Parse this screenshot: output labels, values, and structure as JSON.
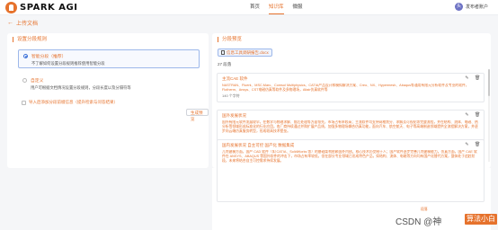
{
  "app": {
    "logo_text": "SPARK AGI"
  },
  "nav": {
    "items": [
      "首页",
      "知识库",
      "微服"
    ],
    "active_index": 1
  },
  "user": {
    "avatar_text": "头",
    "name": "发布者账户"
  },
  "subbar": {
    "back_label": "上传文档"
  },
  "left_panel": {
    "title": "设置分段规则",
    "options": [
      {
        "title": "智能分段（推荐）",
        "desc": "不了解如何设置分段规则推荐使用智能分段",
        "selected": true
      },
      {
        "title": "自定义",
        "desc": "用户可根据文档情况设置分段规则，分段长度以及分隔符等",
        "selected": false
      }
    ],
    "checkbox_label": "导入后添加分段前缀信息（提升检索与问答结果）",
    "generate_button": "生成预览"
  },
  "right_panel": {
    "title": "分段预览",
    "file_name": "信息工具调研报告.docx",
    "segment_count": "27 段落",
    "segments": [
      {
        "title": "主流CAE 软件",
        "body": "NASTRAN、Fluent、MSC.Marc、Comsol Multiphysics、CATIA产品设计和模拟解决方案、Creo、NX、Hypermesh、Abaqus等通用有限元分析软件及专业的软件，Flotherm、Ansys、CST电磁仿真等软件及多物理场，Altair仿真软件等",
        "chars": "140 个字符"
      },
      {
        "title": "国外发展状况",
        "body": "国外有限元软件发展较早，在数学与物理求解、前后处理等方面领先，市场占有率较高；主流软件均支持网格划分、求解及可视化等完整流程，并在结构、流体、电磁、热分析等领域形成标准化的行业应用。各厂商持续通过并购扩展产品线，加强多物理场耦合仿真功能，面向汽车、航空航天、电子等高端制造领域提供全流程解决方案，并逐步向云端仿真服务转型，形成较高技术壁垒。",
        "chars": "245 个字符"
      },
      {
        "title": "国内发展状况 自主可控 国产化 数据集成",
        "body": "几何建模方面，国产 CAD 软件（如 CATIA、SolidWorks 等）的基础架构依赖国外内核，核心技术仍受制于人；国产软件逐步完善几何建模能力。仿真方面，国产 CAE 软件在 ANSYS、ABAQUS 等国外软件的冲击下，市场占有率较低，但在部分专业领域已形成特色产品，如结构、流体、电磁等方向均有国产化替代方案，整体处于追赶阶段，未来将结合自主可控需求持续发展。",
        "chars": ""
      }
    ]
  },
  "watermark": {
    "text": "CSDN @神",
    "badge": "算法小白",
    "corner": "段落"
  }
}
